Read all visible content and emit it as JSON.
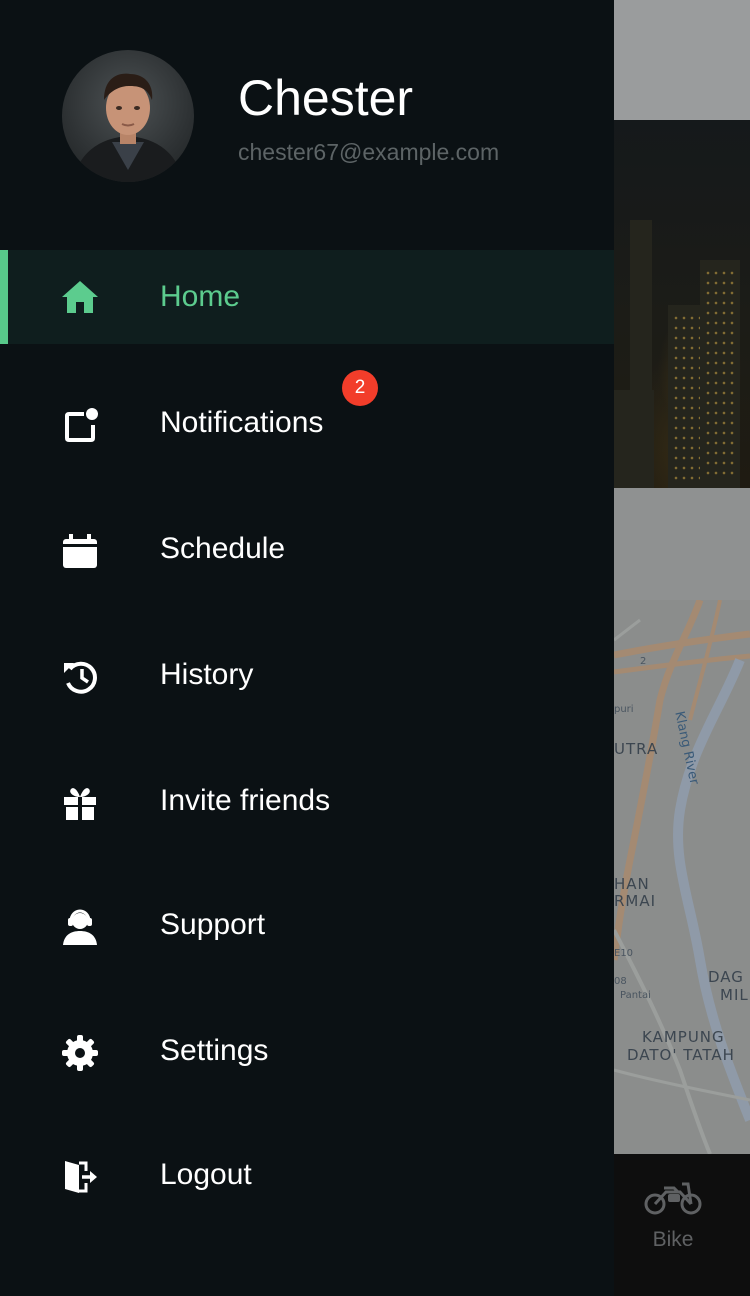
{
  "drawer": {
    "user": {
      "name": "Chester",
      "email": "chester67@example.com"
    },
    "items": [
      {
        "label": "Home",
        "icon": "home-icon",
        "active": true
      },
      {
        "label": "Notifications",
        "icon": "notification-icon",
        "badge": "2"
      },
      {
        "label": "Schedule",
        "icon": "calendar-icon"
      },
      {
        "label": "History",
        "icon": "history-icon"
      },
      {
        "label": "Invite friends",
        "icon": "gift-icon"
      },
      {
        "label": "Support",
        "icon": "support-agent-icon"
      },
      {
        "label": "Settings",
        "icon": "gear-icon"
      },
      {
        "label": "Logout",
        "icon": "logout-icon"
      }
    ],
    "colors": {
      "background": "#0b1114",
      "accent": "#5ccc8e",
      "badge": "#f23d2a"
    }
  },
  "background": {
    "map_labels": [
      "2",
      "puri",
      "Klang River",
      "UTRA",
      "HAN",
      "RMAI",
      "E10",
      "08",
      "Pantai",
      "DAG",
      "MIL",
      "KAMPUNG",
      "DATO' TATAH"
    ],
    "bottom_tab": {
      "label": "Bike",
      "icon": "motorcycle-icon"
    }
  }
}
